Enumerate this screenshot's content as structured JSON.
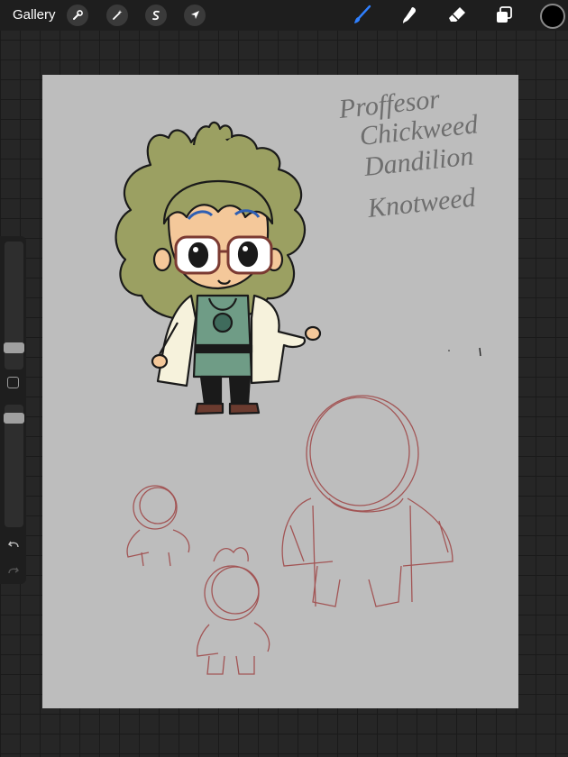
{
  "topbar": {
    "gallery_label": "Gallery",
    "actions": [
      "wrench-icon",
      "magic-wand-icon",
      "selection-icon",
      "transform-arrow-icon"
    ],
    "tools": [
      "brush-icon",
      "smudge-icon",
      "eraser-icon",
      "layers-icon"
    ],
    "active_tool": "brush-icon",
    "active_color": "#000000",
    "accent": "#2f80ff"
  },
  "canvas": {
    "background": "#bdbdbd",
    "handwriting": [
      "Proffesor",
      "Chickweed",
      "Dandilion",
      "Knotweed"
    ],
    "sketch_color": "#a04a4a"
  },
  "sidebar": {
    "brush_size_fraction": 0.2,
    "opacity_fraction": 0.06
  }
}
